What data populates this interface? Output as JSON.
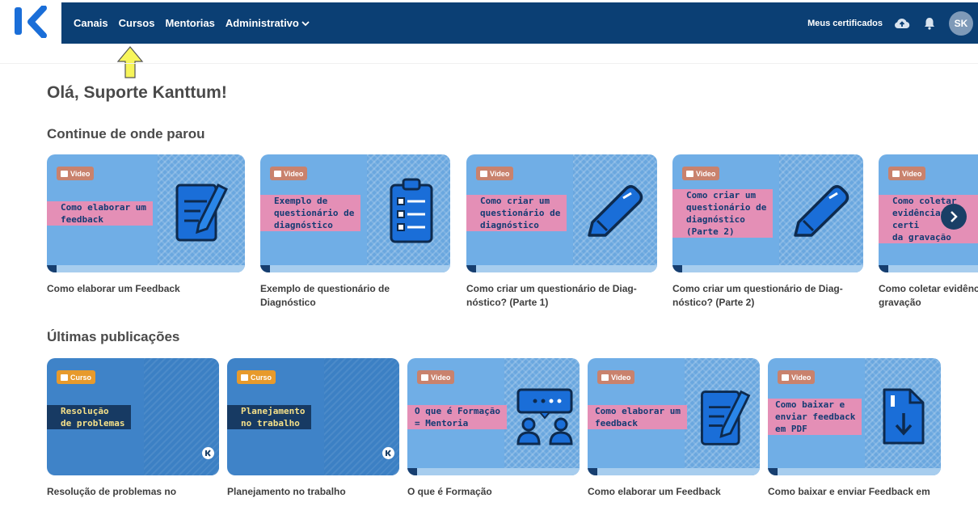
{
  "header": {
    "nav": [
      "Canais",
      "Cursos",
      "Mentorias",
      "Administrativo"
    ],
    "certificates_label": "Meus certificados",
    "avatar_initials": "SK"
  },
  "greeting": "Olá, Suporte Kanttum!",
  "continue_section": {
    "title": "Continue de onde parou",
    "cards": [
      {
        "badge": "Video",
        "thumb_lines": [
          "Como elaborar um",
          "feedback"
        ],
        "title_lines": [
          "Como elaborar um Feedback"
        ],
        "icon": "document-pencil-icon"
      },
      {
        "badge": "Video",
        "thumb_lines": [
          "Exemplo de",
          "questionário de",
          "diagnóstico"
        ],
        "title_lines": [
          "Exemplo de questionário de",
          "Diagnóstico"
        ],
        "icon": "clipboard-checklist-icon"
      },
      {
        "badge": "Video",
        "thumb_lines": [
          "Como criar um",
          "questionário de",
          "diagnóstico"
        ],
        "title_lines": [
          "Como criar um questionário de Diag-",
          "nóstico? (Parte 1)"
        ],
        "icon": "pencil-icon"
      },
      {
        "badge": "Video",
        "thumb_lines": [
          "Como criar um",
          "questionário de",
          "diagnóstico",
          "(Parte 2)"
        ],
        "title_lines": [
          "Como criar um questionário de Diag-",
          "nóstico? (Parte 2)"
        ],
        "icon": "pencil-icon"
      },
      {
        "badge": "Video",
        "thumb_lines": [
          "Como coletar",
          "evidências certi",
          "da gravação"
        ],
        "title_lines": [
          "Como coletar evidênc",
          "gravação"
        ],
        "icon": "none"
      }
    ]
  },
  "latest_section": {
    "title": "Últimas publicações",
    "cards": [
      {
        "badge": "Curso",
        "thumb_lines": [
          "Resolução",
          "de problemas"
        ],
        "title_lines": [
          "Resolução de problemas no"
        ]
      },
      {
        "badge": "Curso",
        "thumb_lines": [
          "Planejamento",
          "no trabalho"
        ],
        "title_lines": [
          "Planejamento no trabalho"
        ]
      },
      {
        "badge": "Video",
        "thumb_lines": [
          "O que é Formação",
          "= Mentoria"
        ],
        "title_lines": [
          "O que é Formação"
        ],
        "icon": "mentoring-people-icon"
      },
      {
        "badge": "Video",
        "thumb_lines": [
          "Como elaborar um",
          "feedback"
        ],
        "title_lines": [
          "Como elaborar um Feedback"
        ],
        "icon": "document-pencil-icon"
      },
      {
        "badge": "Video",
        "thumb_lines": [
          "Como baixar e",
          "enviar feedback",
          "em PDF"
        ],
        "title_lines": [
          "Como baixar e enviar Feedback em"
        ],
        "icon": "pdf-download-icon"
      }
    ]
  },
  "colors": {
    "navbar": "#0b3f74",
    "logo_blue": "#1a6ed8",
    "thumb_blue": "#70aee6",
    "label_pink": "#e48fb6",
    "label_navy": "#173a63",
    "pointer_yellow": "#f7f55a"
  }
}
